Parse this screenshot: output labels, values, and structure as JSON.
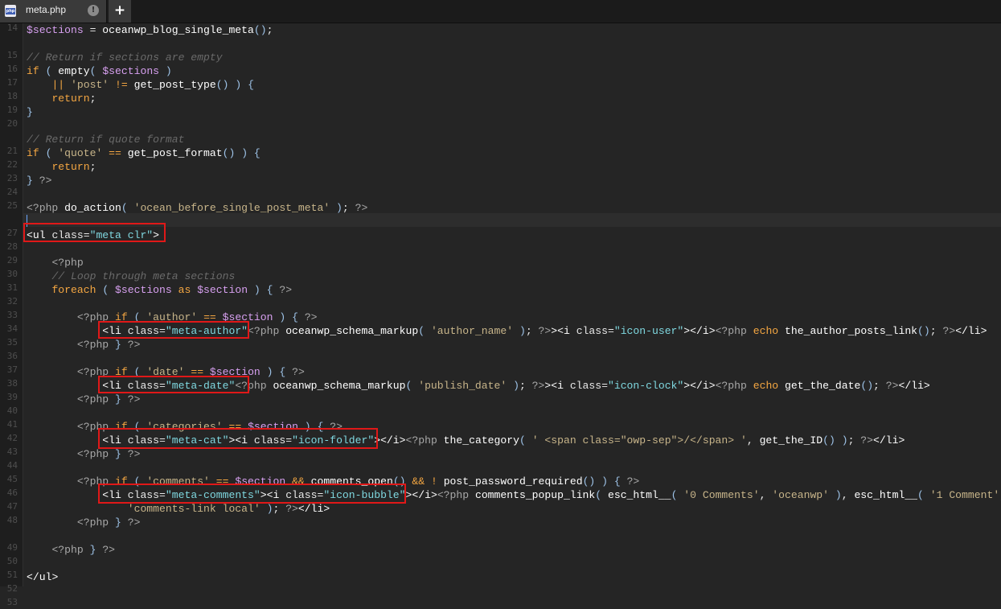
{
  "tab": {
    "title": "meta.php",
    "close": "!",
    "new": "+"
  },
  "line_numbers": [
    "14",
    "",
    "15",
    "16",
    "17",
    "18",
    "19",
    "20",
    "",
    "21",
    "22",
    "23",
    "24",
    "25",
    "",
    "27",
    "28",
    "29",
    "30",
    "31",
    "32",
    "33",
    "34",
    "35",
    "36",
    "37",
    "38",
    "39",
    "40",
    "41",
    "42",
    "43",
    "44",
    "45",
    "46",
    "47",
    "48",
    "",
    "49",
    "50",
    "51",
    "52",
    "53"
  ],
  "code": [
    "$sections = oceanwp_blog_single_meta();",
    "",
    "// Return if sections are empty",
    "if ( empty( $sections )",
    "    || 'post' != get_post_type() ) {",
    "    return;",
    "}",
    "",
    "// Return if quote format",
    "if ( 'quote' == get_post_format() ) {",
    "    return;",
    "} ?>",
    "",
    "<?php do_action( 'ocean_before_single_post_meta' ); ?>",
    "",
    "<ul class=\"meta clr\">",
    "",
    "    <?php",
    "    // Loop through meta sections",
    "    foreach ( $sections as $section ) { ?>",
    "",
    "        <?php if ( 'author' == $section ) { ?>",
    "            <li class=\"meta-author\"<?php oceanwp_schema_markup( 'author_name' ); ?>><i class=\"icon-user\"></i><?php echo the_author_posts_link(); ?></li>",
    "        <?php } ?>",
    "",
    "        <?php if ( 'date' == $section ) { ?>",
    "            <li class=\"meta-date\"<?php oceanwp_schema_markup( 'publish_date' ); ?>><i class=\"icon-clock\"></i><?php echo get_the_date(); ?></li>",
    "        <?php } ?>",
    "",
    "        <?php if ( 'categories' == $section ) { ?>",
    "            <li class=\"meta-cat\"><i class=\"icon-folder\"></i><?php the_category( ' <span class=\"owp-sep\">/</span> ', get_the_ID() ); ?></li>",
    "        <?php } ?>",
    "",
    "        <?php if ( 'comments' == $section && comments_open() && ! post_password_required() ) { ?>",
    "            <li class=\"meta-comments\"><i class=\"icon-bubble\"></i><?php comments_popup_link( esc_html__( '0 Comments', 'oceanwp' ), esc_html__( '1 Comment',",
    "                'comments-link local' ); ?></li>",
    "        <?php } ?>",
    "",
    "    <?php } ?>",
    "",
    "</ul>"
  ]
}
